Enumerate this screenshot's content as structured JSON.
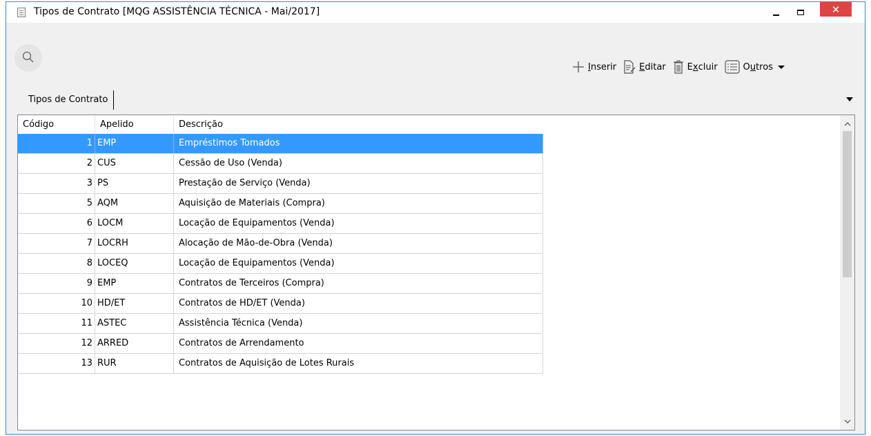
{
  "window": {
    "title": "Tipos de Contrato [MQG ASSISTÊNCIA TÉCNICA - Mai/2017]",
    "close_glyph": "✕"
  },
  "toolbar": {
    "insert_label": "Inserir",
    "insert_key": "I",
    "edit_label": "Editar",
    "edit_key": "E",
    "delete_label": "Excluir",
    "delete_key_pre": "E",
    "delete_key": "x",
    "delete_rest": "cluir",
    "others_label": "Outros",
    "others_pre": "O",
    "others_key": "u",
    "others_rest": "tros",
    "icons": [
      "plus-icon",
      "edit-document-icon",
      "trash-icon",
      "list-icon",
      "dropdown-arrow-icon"
    ]
  },
  "tabs": [
    {
      "label": "Tipos de Contrato"
    }
  ],
  "grid": {
    "columns": [
      "Código",
      "Apelido",
      "Descrição"
    ],
    "selected_row_index": 0,
    "selection_color": "#3399ff",
    "rows": [
      {
        "codigo": "1",
        "apelido": "EMP",
        "descricao": "Empréstimos Tomados"
      },
      {
        "codigo": "2",
        "apelido": "CUS",
        "descricao": "Cessão de Uso (Venda)"
      },
      {
        "codigo": "3",
        "apelido": "PS",
        "descricao": "Prestação de Serviço (Venda)"
      },
      {
        "codigo": "5",
        "apelido": "AQM",
        "descricao": "Aquisição de Materiais (Compra)"
      },
      {
        "codigo": "6",
        "apelido": "LOCM",
        "descricao": "Locação de Equipamentos (Venda)"
      },
      {
        "codigo": "7",
        "apelido": "LOCRH",
        "descricao": "Alocação de Mão-de-Obra (Venda)"
      },
      {
        "codigo": "8",
        "apelido": "LOCEQ",
        "descricao": "Locação de Equipamentos (Venda)"
      },
      {
        "codigo": "9",
        "apelido": "EMP",
        "descricao": "Contratos de Terceiros (Compra)"
      },
      {
        "codigo": "10",
        "apelido": "HD/ET",
        "descricao": "Contratos de HD/ET (Venda)"
      },
      {
        "codigo": "11",
        "apelido": "ASTEC",
        "descricao": "Assistência Técnica (Venda)"
      },
      {
        "codigo": "12",
        "apelido": "ARRED",
        "descricao": "Contratos de Arrendamento"
      },
      {
        "codigo": "13",
        "apelido": "RUR",
        "descricao": "Contratos de Aquisição de Lotes Rurais"
      }
    ]
  }
}
